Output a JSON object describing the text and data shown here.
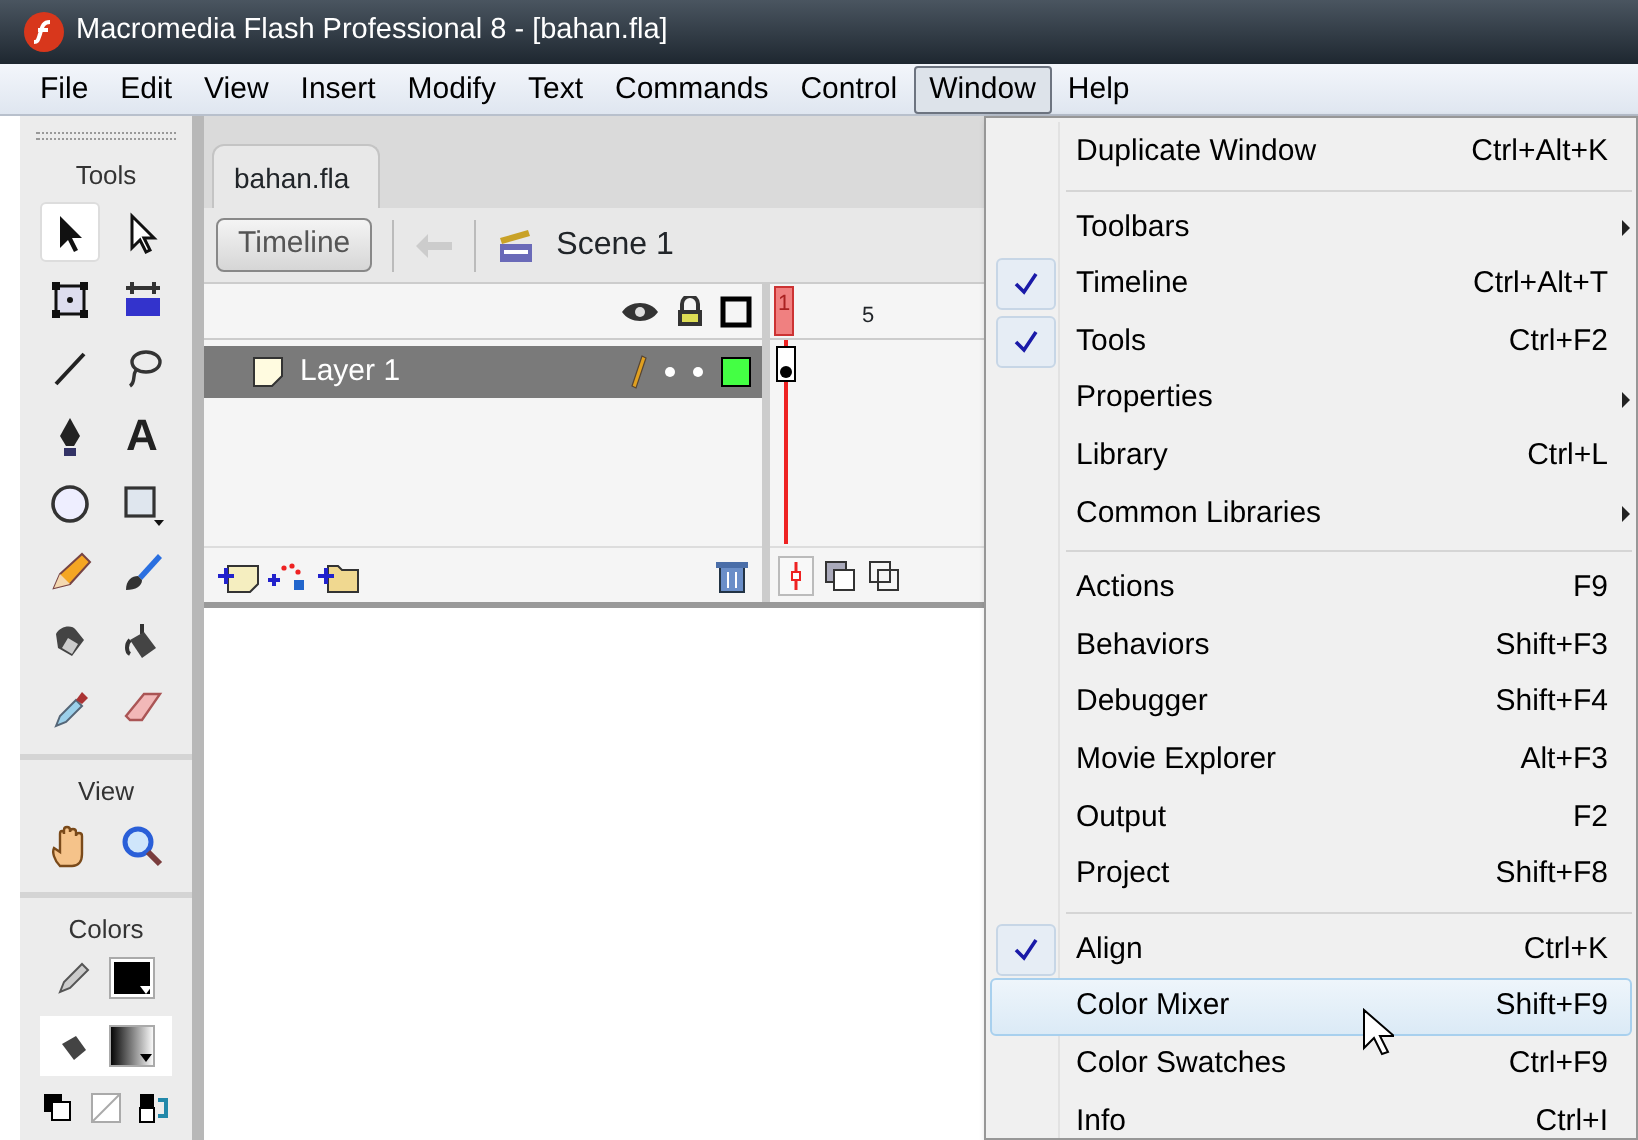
{
  "window": {
    "title": "Macromedia Flash Professional 8 - [bahan.fla]"
  },
  "menubar": [
    {
      "label": "File",
      "selected": false
    },
    {
      "label": "Edit",
      "selected": false
    },
    {
      "label": "View",
      "selected": false
    },
    {
      "label": "Insert",
      "selected": false
    },
    {
      "label": "Modify",
      "selected": false
    },
    {
      "label": "Text",
      "selected": false
    },
    {
      "label": "Commands",
      "selected": false
    },
    {
      "label": "Control",
      "selected": false
    },
    {
      "label": "Window",
      "selected": true
    },
    {
      "label": "Help",
      "selected": false
    }
  ],
  "tools_panel": {
    "sections": [
      {
        "heading": "Tools",
        "tools": [
          {
            "kind": "selection",
            "selected": true
          },
          {
            "kind": "subselection",
            "selected": false
          },
          {
            "kind": "free-transform",
            "selected": false
          },
          {
            "kind": "gradient-transform",
            "selected": false
          },
          {
            "kind": "line",
            "selected": false
          },
          {
            "kind": "lasso",
            "selected": false
          },
          {
            "kind": "pen",
            "selected": false
          },
          {
            "kind": "text",
            "glyph": "A",
            "selected": false
          },
          {
            "kind": "oval",
            "selected": false
          },
          {
            "kind": "rectangle",
            "selected": false
          },
          {
            "kind": "pencil",
            "selected": false
          },
          {
            "kind": "brush",
            "selected": false
          },
          {
            "kind": "ink-bottle",
            "selected": false
          },
          {
            "kind": "paint-bucket",
            "selected": false
          },
          {
            "kind": "eyedropper",
            "selected": false
          },
          {
            "kind": "eraser",
            "selected": false
          }
        ]
      },
      {
        "heading": "View",
        "tools": [
          {
            "kind": "hand",
            "selected": false
          },
          {
            "kind": "zoom",
            "selected": false
          }
        ]
      },
      {
        "heading": "Colors"
      }
    ]
  },
  "document": {
    "tab": "bahan.fla",
    "timeline_button": "Timeline",
    "scene": "Scene 1",
    "layers": [
      {
        "name": "Layer 1",
        "selected": true
      }
    ],
    "frame_numbers": [
      "1",
      "5"
    ]
  },
  "window_menu": {
    "sections": [
      [
        {
          "label": "Duplicate Window",
          "shortcut": "Ctrl+Alt+K",
          "checked": false,
          "submenu": false,
          "hovered": false
        }
      ],
      [
        {
          "label": "Toolbars",
          "checked": false,
          "submenu": true,
          "hovered": false
        },
        {
          "label": "Timeline",
          "shortcut": "Ctrl+Alt+T",
          "checked": true,
          "submenu": false,
          "hovered": false
        },
        {
          "label": "Tools",
          "shortcut": "Ctrl+F2",
          "checked": true,
          "submenu": false,
          "hovered": false
        },
        {
          "label": "Properties",
          "checked": false,
          "submenu": true,
          "hovered": false
        },
        {
          "label": "Library",
          "shortcut": "Ctrl+L",
          "checked": false,
          "submenu": false,
          "hovered": false
        },
        {
          "label": "Common Libraries",
          "checked": false,
          "submenu": true,
          "hovered": false
        }
      ],
      [
        {
          "label": "Actions",
          "shortcut": "F9",
          "checked": false,
          "submenu": false,
          "hovered": false
        },
        {
          "label": "Behaviors",
          "shortcut": "Shift+F3",
          "checked": false,
          "submenu": false,
          "hovered": false
        },
        {
          "label": "Debugger",
          "shortcut": "Shift+F4",
          "checked": false,
          "submenu": false,
          "hovered": false
        },
        {
          "label": "Movie Explorer",
          "shortcut": "Alt+F3",
          "checked": false,
          "submenu": false,
          "hovered": false
        },
        {
          "label": "Output",
          "shortcut": "F2",
          "checked": false,
          "submenu": false,
          "hovered": false
        },
        {
          "label": "Project",
          "shortcut": "Shift+F8",
          "checked": false,
          "submenu": false,
          "hovered": false
        }
      ],
      [
        {
          "label": "Align",
          "shortcut": "Ctrl+K",
          "checked": true,
          "submenu": false,
          "hovered": false
        },
        {
          "label": "Color Mixer",
          "shortcut": "Shift+F9",
          "checked": false,
          "submenu": false,
          "hovered": true
        },
        {
          "label": "Color Swatches",
          "shortcut": "Ctrl+F9",
          "checked": false,
          "submenu": false,
          "hovered": false
        },
        {
          "label": "Info",
          "shortcut": "Ctrl+I",
          "checked": false,
          "submenu": false,
          "hovered": false
        }
      ]
    ]
  }
}
